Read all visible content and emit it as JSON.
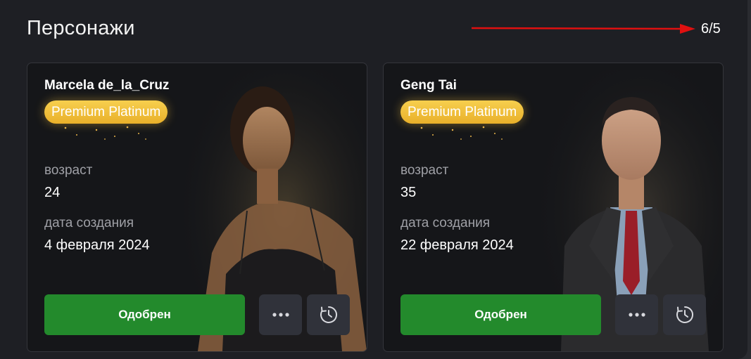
{
  "page": {
    "title": "Персонажи",
    "counter": "6/5"
  },
  "colors": {
    "background": "#1e1f24",
    "card": "#151619",
    "badge": "#f0be3a",
    "approve": "#238a2c",
    "icon_button": "#30323a",
    "arrow": "#e01010"
  },
  "labels": {
    "age": "возраст",
    "created": "дата создания"
  },
  "characters": [
    {
      "name": "Marcela de_la_Cruz",
      "badge": "Premium Platinum",
      "age": "24",
      "created": "4 февраля 2024",
      "status_button": "Одобрен",
      "portrait": "female-character-portrait"
    },
    {
      "name": "Geng Tai",
      "badge": "Premium Platinum",
      "age": "35",
      "created": "22 февраля 2024",
      "status_button": "Одобрен",
      "portrait": "male-character-portrait-suit"
    }
  ],
  "icons": {
    "more": "more-dots-icon",
    "history": "history-clock-icon"
  }
}
